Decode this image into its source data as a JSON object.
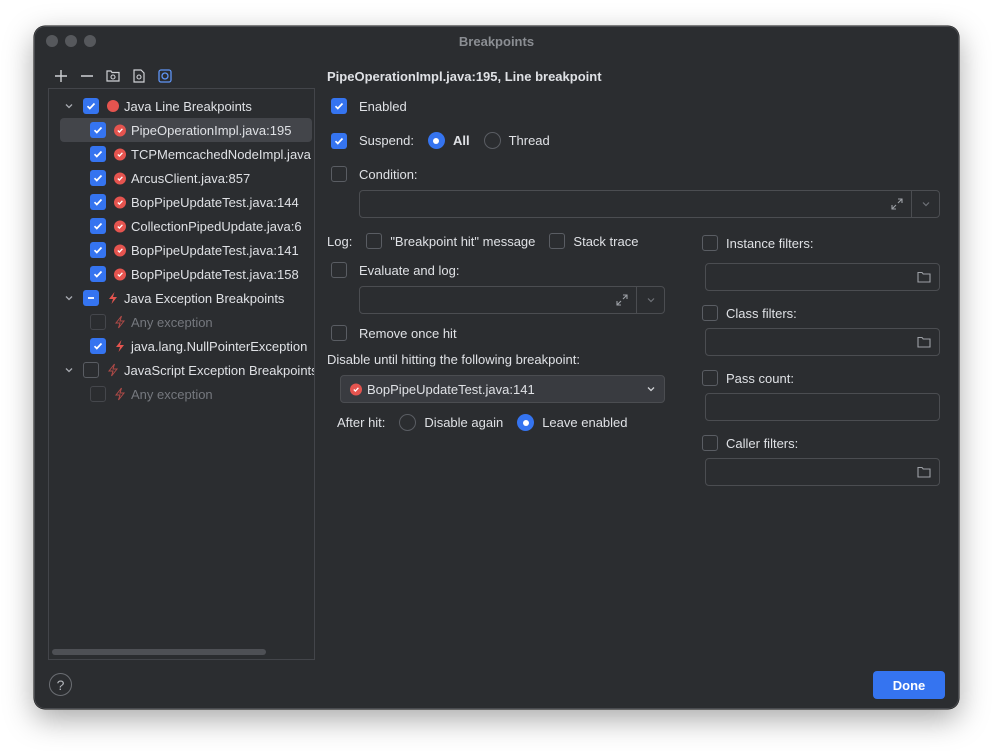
{
  "window": {
    "title": "Breakpoints"
  },
  "toolbar": {
    "icons": [
      "plus-icon",
      "minus-icon",
      "group-by-package-icon",
      "group-by-file-icon",
      "group-by-class-icon"
    ]
  },
  "tree": {
    "groups": [
      {
        "label": "Java Line Breakpoints",
        "checked": "on",
        "icon": "breakpoint-dot-icon"
      },
      {
        "label": "Java Exception Breakpoints",
        "checked": "mixed",
        "icon": "lightning-icon"
      },
      {
        "label": "JavaScript Exception Breakpoints",
        "checked": "off",
        "icon": "lightning-icon"
      }
    ],
    "line_items": [
      {
        "label": "PipeOperationImpl.java:195",
        "selected": true
      },
      {
        "label": "TCPMemcachedNodeImpl.java"
      },
      {
        "label": "ArcusClient.java:857"
      },
      {
        "label": "BopPipeUpdateTest.java:144"
      },
      {
        "label": "CollectionPipedUpdate.java:6"
      },
      {
        "label": "BopPipeUpdateTest.java:141"
      },
      {
        "label": "BopPipeUpdateTest.java:158"
      }
    ],
    "exception_items": [
      {
        "label": "Any exception",
        "disabled": true
      },
      {
        "label": "java.lang.NullPointerException"
      }
    ],
    "js_items": [
      {
        "label": "Any exception",
        "disabled": true
      }
    ]
  },
  "details": {
    "heading": "PipeOperationImpl.java:195, Line breakpoint",
    "enabled_label": "Enabled",
    "suspend_label": "Suspend:",
    "suspend_all": "All",
    "suspend_thread": "Thread",
    "condition_label": "Condition:",
    "log_label": "Log:",
    "log_message_label": "\"Breakpoint hit\" message",
    "stack_trace_label": "Stack trace",
    "evaluate_label": "Evaluate and log:",
    "remove_once_label": "Remove once hit",
    "disable_until_label": "Disable until hitting the following breakpoint:",
    "disable_until_value": "BopPipeUpdateTest.java:141",
    "after_hit_label": "After hit:",
    "disable_again_label": "Disable again",
    "leave_enabled_label": "Leave enabled",
    "instance_filters_label": "Instance filters:",
    "class_filters_label": "Class filters:",
    "pass_count_label": "Pass count:",
    "caller_filters_label": "Caller filters:"
  },
  "footer": {
    "help": "?",
    "done_label": "Done"
  },
  "colors": {
    "accent": "#3574f0",
    "breakpoint_red": "#e5544f",
    "background": "#2b2d30"
  }
}
